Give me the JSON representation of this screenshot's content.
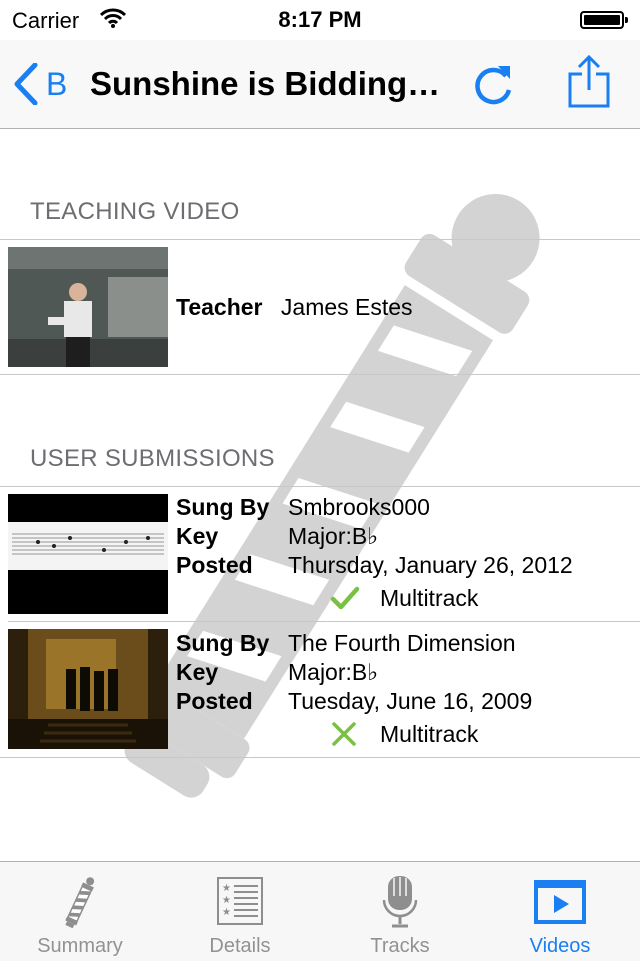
{
  "status_bar": {
    "carrier": "Carrier",
    "time": "8:17 PM"
  },
  "nav": {
    "back_label": "B",
    "title": "Sunshine is Bidding…"
  },
  "teaching": {
    "header": "TEACHING VIDEO",
    "teacher_label": "Teacher",
    "teacher_name": "James Estes"
  },
  "submissions": {
    "header": "USER SUBMISSIONS",
    "items": [
      {
        "sung_by_label": "Sung By",
        "sung_by": "Smbrooks000",
        "key_label": "Key",
        "key": "Major:B♭",
        "posted_label": "Posted",
        "posted": "Thursday, January 26, 2012",
        "multitrack_label": "Multitrack",
        "multitrack": true
      },
      {
        "sung_by_label": "Sung By",
        "sung_by": "The Fourth Dimension",
        "key_label": "Key",
        "key": "Major:B♭",
        "posted_label": "Posted",
        "posted": "Tuesday, June 16, 2009",
        "multitrack_label": "Multitrack",
        "multitrack": false
      }
    ]
  },
  "tabs": [
    {
      "label": "Summary",
      "icon": "barber-pole-icon",
      "active": false
    },
    {
      "label": "Details",
      "icon": "list-icon",
      "active": false
    },
    {
      "label": "Tracks",
      "icon": "microphone-icon",
      "active": false
    },
    {
      "label": "Videos",
      "icon": "play-video-icon",
      "active": true
    }
  ],
  "colors": {
    "accent": "#1a7ff0",
    "check": "#7ac143",
    "inactive_tab": "#929292",
    "section_header": "#6d6d72"
  }
}
